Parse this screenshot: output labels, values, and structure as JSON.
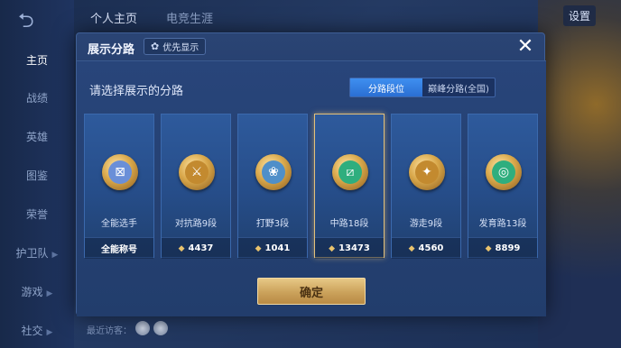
{
  "background": {
    "top_tabs": [
      "个人主页",
      "电竞生涯"
    ],
    "sidebar_items": [
      "主页",
      "战绩",
      "英雄",
      "图鉴",
      "荣誉",
      "护卫队",
      "游戏",
      "社交"
    ],
    "settings_label": "设置",
    "recent_visitors_label": "最近访客："
  },
  "modal": {
    "title": "展示分路",
    "priority_button_label": "优先显示",
    "close_label": "✕",
    "prompt": "请选择展示的分路",
    "switch": {
      "options": [
        "分路段位",
        "巅峰分路(全国)"
      ],
      "selected": "分路段位"
    },
    "cards": [
      {
        "label": "全能选手",
        "footer": "全能称号",
        "icon": "all-round-emblem",
        "color": "#6a8fd8",
        "selected": false
      },
      {
        "label": "对抗路9段",
        "footer": "4437",
        "icon": "clash-lane-emblem",
        "color": "#c38a2f",
        "selected": false
      },
      {
        "label": "打野3段",
        "footer": "1041",
        "icon": "jungle-emblem",
        "color": "#4f8fc9",
        "selected": false
      },
      {
        "label": "中路18段",
        "footer": "13473",
        "icon": "mid-lane-emblem",
        "color": "#2fae7e",
        "selected": true
      },
      {
        "label": "游走9段",
        "footer": "4560",
        "icon": "roam-emblem",
        "color": "#c38a2f",
        "selected": false
      },
      {
        "label": "发育路13段",
        "footer": "8899",
        "icon": "farm-lane-emblem",
        "color": "#2fae7e",
        "selected": false
      }
    ],
    "confirm_label": "确定"
  },
  "colors": {
    "accent_blue": "#3f8ff0",
    "gold": "#e3c07a",
    "panel": "#223d6c"
  }
}
